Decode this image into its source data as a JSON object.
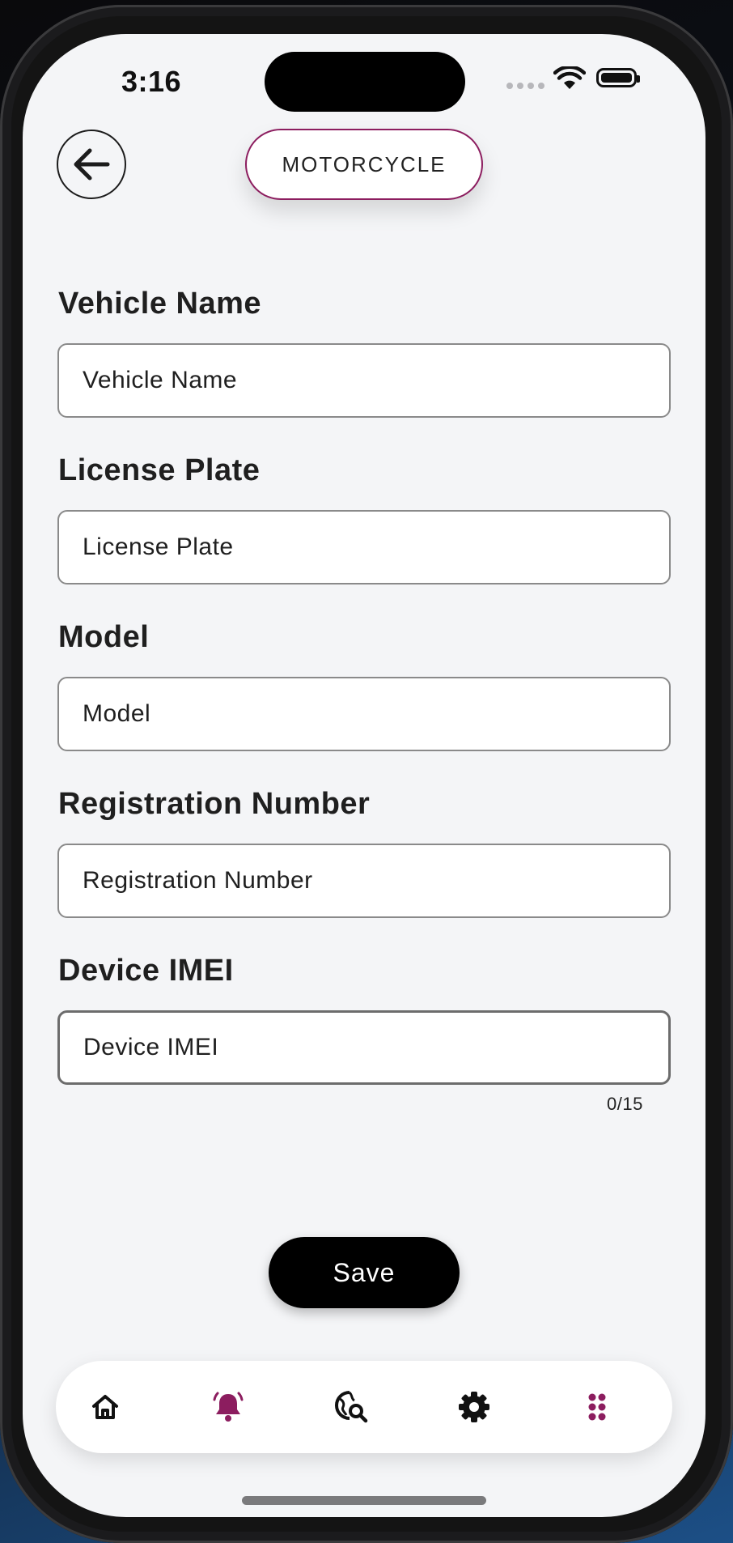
{
  "status_bar": {
    "time": "3:16"
  },
  "header": {
    "vehicle_type": "MOTORCYCLE"
  },
  "form": {
    "fields": [
      {
        "label": "Vehicle Name",
        "placeholder": "Vehicle Name",
        "value": ""
      },
      {
        "label": "License Plate",
        "placeholder": "License Plate",
        "value": ""
      },
      {
        "label": "Model",
        "placeholder": "Model",
        "value": ""
      },
      {
        "label": "Registration Number",
        "placeholder": "Registration Number",
        "value": ""
      },
      {
        "label": "Device IMEI",
        "placeholder": "Device IMEI",
        "value": "",
        "counter": "0/15",
        "focused": true
      }
    ],
    "save_label": "Save"
  },
  "bottom_nav": {
    "items": [
      {
        "icon": "home-icon",
        "active": false
      },
      {
        "icon": "bell-icon",
        "active": true
      },
      {
        "icon": "globe-search-icon",
        "active": false
      },
      {
        "icon": "gear-icon",
        "active": false
      },
      {
        "icon": "grid-dots-icon",
        "active": true
      }
    ]
  },
  "colors": {
    "accent": "#8c1d5f",
    "background": "#f4f5f7",
    "button": "#000000"
  }
}
